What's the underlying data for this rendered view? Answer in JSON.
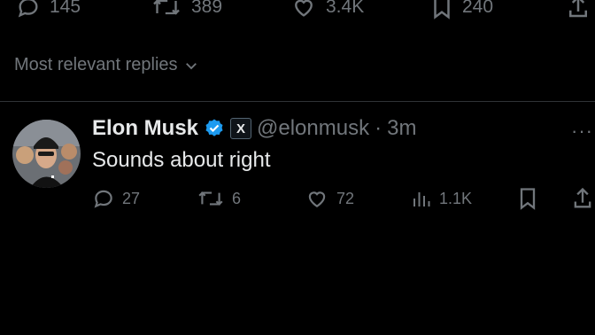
{
  "tweet_actions": {
    "reply_count": "145",
    "repost_count": "389",
    "like_count": "3.4K",
    "bookmark_count": "240"
  },
  "replies_sort": {
    "label": "Most relevant replies"
  },
  "reply": {
    "author_name": "Elon Musk",
    "verified_badge": "blue-check-icon",
    "affiliation_badge": "X",
    "handle": "@elonmusk",
    "separator": "·",
    "time": "3m",
    "more": "···",
    "text": "Sounds about right",
    "actions": {
      "reply_count": "27",
      "repost_count": "6",
      "like_count": "72",
      "views_count": "1.1K"
    }
  },
  "colors": {
    "background": "#000000",
    "text_primary": "#e7e9ea",
    "text_secondary": "#71767b",
    "verified_blue": "#1d9bf0",
    "divider": "#2f3336"
  }
}
